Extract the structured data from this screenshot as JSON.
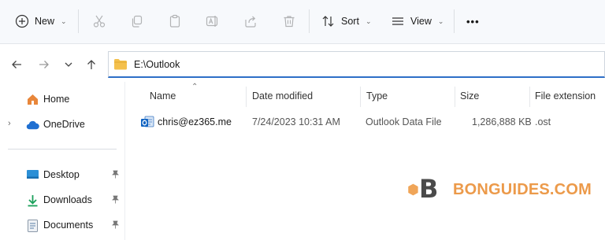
{
  "toolbar": {
    "new_label": "New",
    "sort_label": "Sort",
    "view_label": "View",
    "more_label": "•••"
  },
  "address": {
    "path": "E:\\Outlook"
  },
  "sidebar": {
    "items": [
      {
        "label": "Home"
      },
      {
        "label": "OneDrive"
      },
      {
        "label": "Desktop"
      },
      {
        "label": "Downloads"
      },
      {
        "label": "Documents"
      }
    ]
  },
  "columns": {
    "name": "Name",
    "date_modified": "Date modified",
    "type": "Type",
    "size": "Size",
    "file_extension": "File extension"
  },
  "files": [
    {
      "name": "chris@ez365.me",
      "date_modified": "7/24/2023 10:31 AM",
      "type": "Outlook Data File",
      "size": "1,286,888 KB",
      "extension": ".ost"
    }
  ],
  "watermark": {
    "letter": "B",
    "text": "BONGUIDES.COM"
  },
  "colors": {
    "accent": "#2e6fc7",
    "folder": "#f4c04c",
    "watermark": "#ec9a4a"
  }
}
